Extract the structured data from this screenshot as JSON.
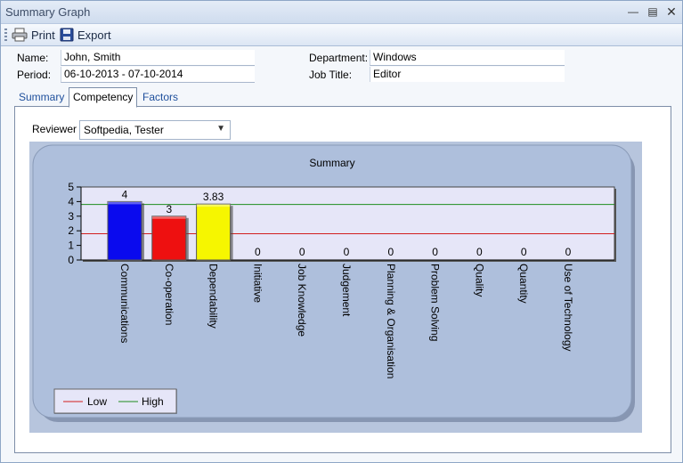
{
  "window": {
    "title": "Summary Graph"
  },
  "toolbar": {
    "print_label": "Print",
    "export_label": "Export"
  },
  "info": {
    "name_label": "Name:",
    "name_value": "John, Smith",
    "period_label": "Period:",
    "period_value": "06-10-2013 - 07-10-2014",
    "department_label": "Department:",
    "department_value": "Windows",
    "jobtitle_label": "Job Title:",
    "jobtitle_value": "Editor"
  },
  "tabs": [
    {
      "label": "Summary",
      "active": false
    },
    {
      "label": "Competency",
      "active": true
    },
    {
      "label": "Factors",
      "active": false
    }
  ],
  "reviewer": {
    "label": "Reviewer",
    "value": "Softpedia, Tester"
  },
  "colors": {
    "low_line": "#d21e1e",
    "high_line": "#1e8c1e",
    "plot_bg": "#e6e6f8",
    "chart_bg": "#b7c5dd",
    "card_bg": "#aebfdc"
  },
  "chart_data": {
    "type": "bar",
    "title": "Summary",
    "categories": [
      "Communications",
      "Co-operation",
      "Dependability",
      "Initiative",
      "Job Knowledge",
      "Judgement",
      "Planning & Organisation",
      "Problem Solving",
      "Quality",
      "Quantity",
      "Use of Technology"
    ],
    "values": [
      4,
      3,
      3.83,
      0,
      0,
      0,
      0,
      0,
      0,
      0,
      0
    ],
    "value_labels": [
      "4",
      "3",
      "3.83",
      "0",
      "0",
      "0",
      "0",
      "0",
      "0",
      "0",
      "0"
    ],
    "bar_colors": [
      "#0a0aee",
      "#ee1010",
      "#f6f600",
      null,
      null,
      null,
      null,
      null,
      null,
      null,
      null
    ],
    "ylim": [
      0,
      5
    ],
    "yticks": [
      "0",
      "1",
      "2",
      "3",
      "4",
      "5"
    ],
    "reference_lines": [
      {
        "name": "Low",
        "value": 1.8,
        "color": "#d21e1e"
      },
      {
        "name": "High",
        "value": 3.8,
        "color": "#1e8c1e"
      }
    ],
    "legend": {
      "placement": "bottom-left",
      "entries": [
        "Low",
        "High"
      ]
    }
  }
}
